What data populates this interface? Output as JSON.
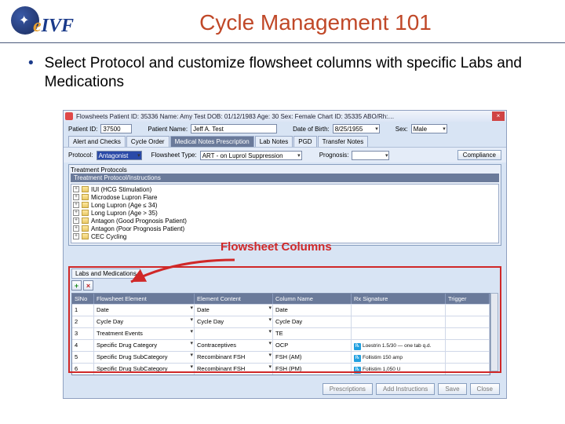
{
  "slide": {
    "logo_e": "e",
    "logo_ivf": "IVF",
    "title": "Cycle Management 101",
    "bullet": "Select Protocol and customize flowsheet columns with specific Labs and Medications",
    "callout": "Flowsheet Columns"
  },
  "app": {
    "titlebar": "Flowsheets   Patient ID: 35336   Name: Amy Test   DOB: 01/12/1983   Age: 30   Sex: Female   Chart ID: 35335   ABO/Rh:…",
    "form": {
      "patient_id_lbl": "Patient ID:",
      "patient_id_val": "37500",
      "patient_name_lbl": "Patient Name:",
      "patient_name_val": "Jeff A. Test",
      "dob_lbl": "Date of Birth:",
      "dob_val": "8/25/1955",
      "sex_lbl": "Sex:",
      "sex_val": "Male"
    },
    "tabs": [
      "Alert and Checks",
      "Cycle Order",
      "Medical Notes Prescription",
      "Lab Notes",
      "PGD",
      "Transfer Notes"
    ],
    "protocol_row": {
      "protocol_lbl": "Protocol:",
      "protocol_val": "Antagonist",
      "flowtype_lbl": "Flowsheet Type:",
      "flowtype_val": "ART - on Luprol Suppression",
      "prognosis_lbl": "Prognosis:",
      "compliance_btn": "Compliance"
    },
    "proto_panel": {
      "title": "Treatment Protocols",
      "subtitle": "Treatment Protocol/Instructions",
      "items": [
        "IUI (HCG Stimulation)",
        "Microdose Lupron Flare",
        "Long Lupron (Age ≤ 34)",
        "Long Lupron (Age > 35)",
        "Antagon (Good Prognosis Patient)",
        "Antagon (Poor Prognosis Patient)",
        "CEC Cycling"
      ]
    },
    "labs_tab": "Labs and Medications",
    "toolbar": {
      "add": "+",
      "del": "×"
    },
    "grid": {
      "headers": [
        "SlNo",
        "Flowsheet Element",
        "Element Content",
        "Column Name",
        "Rx Signature",
        "Trigger"
      ],
      "rows": [
        {
          "n": "1",
          "el": "Date",
          "ec": "Date",
          "cn": "Date",
          "rx": "",
          "tr": ""
        },
        {
          "n": "2",
          "el": "Cycle Day",
          "ec": "Cycle Day",
          "cn": "Cycle Day",
          "rx": "",
          "tr": ""
        },
        {
          "n": "3",
          "el": "Treatment Events",
          "ec": "",
          "cn": "TE",
          "rx": "",
          "tr": ""
        },
        {
          "n": "4",
          "el": "Specific Drug Category",
          "ec": "Contraceptives",
          "cn": "OCP",
          "rx": "Loestrin 1.5/30 — one tab q.d.",
          "tr": ""
        },
        {
          "n": "5",
          "el": "Specific Drug SubCategory",
          "ec": "Recombinant FSH",
          "cn": "FSH (AM)",
          "rx": "Follistim 150 amp",
          "tr": ""
        },
        {
          "n": "6",
          "el": "Specific Drug SubCategory",
          "ec": "Recombinant FSH",
          "cn": "FSH (PM)",
          "rx": "Follistim 1,050 U",
          "tr": ""
        }
      ]
    },
    "footer": [
      "Prescriptions",
      "Add Instructions",
      "Save",
      "Close"
    ]
  }
}
